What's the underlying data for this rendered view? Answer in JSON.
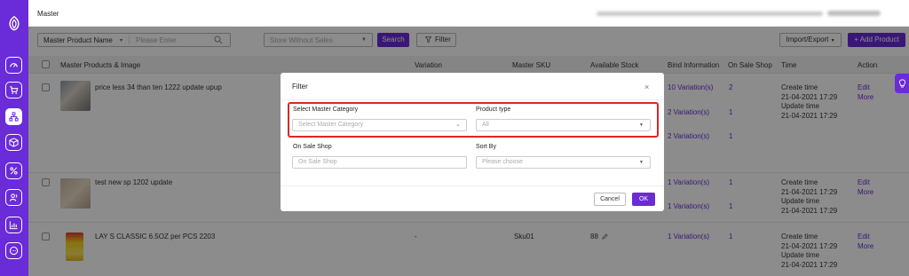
{
  "header": {
    "title": "Master"
  },
  "toolbar": {
    "field_select": "Master Product Name",
    "search_placeholder": "Please Enter",
    "store_placeholder": "Store Without Sales",
    "search_label": "Search",
    "filter_label": "Filter",
    "import_label": "Import/Export",
    "add_label": "+ Add Product"
  },
  "table": {
    "headers": {
      "product": "Master Products & Image",
      "variation": "Variation",
      "sku": "Master SKU",
      "stock": "Available Stock",
      "bind": "Bind Information",
      "onsale": "On Sale Shop",
      "time": "Time",
      "action": "Action"
    },
    "rows": [
      {
        "name": "price less 34 than ten 1222 update upup",
        "bind": [
          "10 Variation(s)",
          "2 Variation(s)",
          "2 Variation(s)"
        ],
        "onsale": [
          "2",
          "1",
          "1"
        ],
        "create_label": "Create time",
        "create_time": "21-04-2021 17:29",
        "update_label": "Update time",
        "update_time": "21-04-2021 17:29",
        "edit": "Edit",
        "more": "More"
      },
      {
        "name": "test new sp 1202 update",
        "bind": [
          "1 Variation(s)",
          "1 Variation(s)"
        ],
        "onsale": [
          "1",
          "1"
        ],
        "create_label": "Create time",
        "create_time": "21-04-2021 17:29",
        "update_label": "Update time",
        "update_time": "21-04-2021 17:29",
        "edit": "Edit",
        "more": "More"
      },
      {
        "name": "LAY S CLASSIC 6.5OZ per PCS 2203",
        "variation": "-",
        "sku": "Sku01",
        "stock": "88",
        "bind": [
          "1 Variation(s)"
        ],
        "onsale": [
          "1"
        ],
        "create_label": "Create time",
        "create_time": "21-04-2021 17:29",
        "update_label": "Update time",
        "update_time": "21-04-2021 17:29",
        "edit": "Edit",
        "more": "More"
      }
    ]
  },
  "modal": {
    "title": "Filter",
    "close": "×",
    "category_label": "Select Master Category",
    "category_placeholder": "Select Master Category",
    "product_type_label": "Product type",
    "product_type_value": "All",
    "shop_label": "On Sale Shop",
    "shop_placeholder": "On Sale Shop",
    "sort_label": "Sort By",
    "sort_placeholder": "Please choose",
    "cancel": "Cancel",
    "ok": "OK"
  },
  "colors": {
    "accent": "#6a2bd9",
    "highlight": "#e02424"
  },
  "icons": {
    "sidebar": [
      "logo-icon",
      "dashboard-icon",
      "cart-icon",
      "product-tree-icon",
      "package-icon",
      "percent-icon",
      "users-icon",
      "chart-icon",
      "chat-icon"
    ]
  }
}
